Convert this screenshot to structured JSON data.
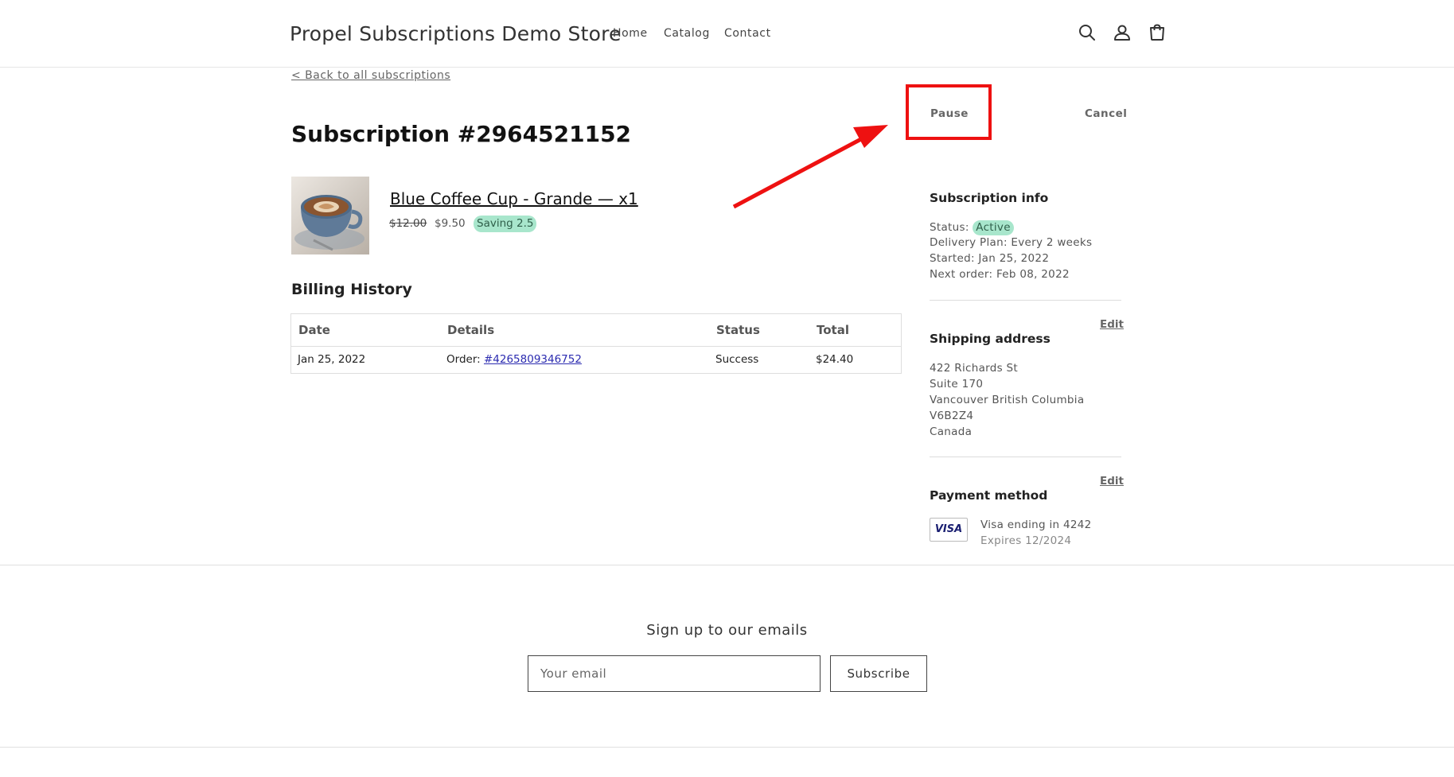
{
  "header": {
    "store_name": "Propel Subscriptions Demo Store",
    "nav": [
      "Home",
      "Catalog",
      "Contact"
    ],
    "icons": [
      "search-icon",
      "account-icon",
      "cart-icon"
    ]
  },
  "back_link": "< Back to all subscriptions",
  "actions": {
    "pause": "Pause",
    "cancel": "Cancel"
  },
  "subscription": {
    "title": "Subscription #2964521152",
    "product": {
      "name": "Blue Coffee Cup - Grande — x1",
      "price_original": "$12.00",
      "price_current": "$9.50",
      "saving": "Saving 2.5"
    }
  },
  "billing": {
    "heading": "Billing History",
    "columns": [
      "Date",
      "Details",
      "Status",
      "Total"
    ],
    "rows": [
      {
        "date": "Jan 25, 2022",
        "details_prefix": "Order: ",
        "order_number": "#4265809346752",
        "status": "Success",
        "total": "$24.40"
      }
    ]
  },
  "info": {
    "heading": "Subscription info",
    "status_label": "Status:",
    "status_value": "Active",
    "delivery_plan": "Delivery Plan: Every 2 weeks",
    "started": "Started: Jan 25, 2022",
    "next_order": "Next order: Feb 08, 2022"
  },
  "shipping": {
    "heading": "Shipping address",
    "edit": "Edit",
    "lines": [
      "422 Richards St",
      "Suite 170",
      "Vancouver British Columbia",
      "V6B2Z4",
      "Canada"
    ]
  },
  "payment": {
    "heading": "Payment method",
    "edit": "Edit",
    "card_brand": "VISA",
    "card_text": "Visa ending in 4242",
    "expires": "Expires 12/2024"
  },
  "footer": {
    "heading": "Sign up to our emails",
    "email_placeholder": "Your email",
    "subscribe": "Subscribe"
  },
  "colors": {
    "accent_badge": "#a8e6cc",
    "annotation_red": "#ee1111",
    "link_blue": "#2b2bb0",
    "visa_blue": "#1a1f71"
  }
}
